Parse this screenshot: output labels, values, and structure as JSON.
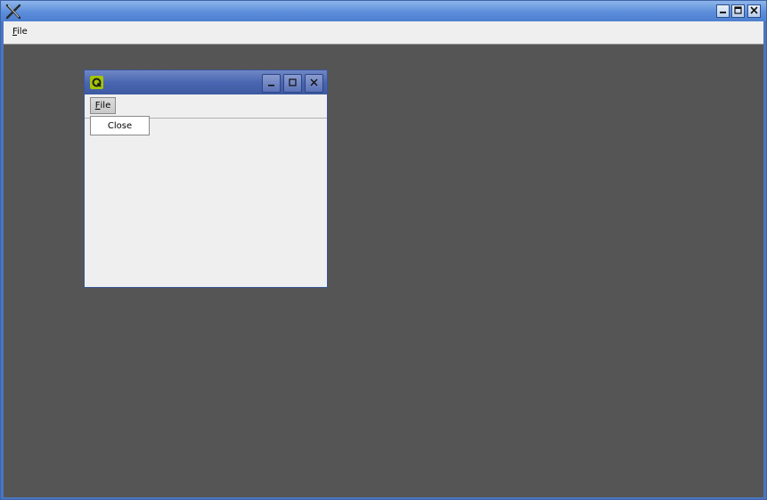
{
  "main_window": {
    "icon": "x-app-icon",
    "menu": {
      "file_underlined": "F",
      "file_rest": "ile"
    }
  },
  "child_window": {
    "icon": "qt-logo-icon",
    "menu": {
      "file_underlined": "F",
      "file_rest": "ile"
    },
    "dropdown": {
      "close_label": "Close"
    }
  },
  "colors": {
    "workspace": "#555555",
    "titlebar": "#5c8ddb",
    "child_titlebar": "#4a66b0",
    "qt_logo": "#a4c400"
  }
}
